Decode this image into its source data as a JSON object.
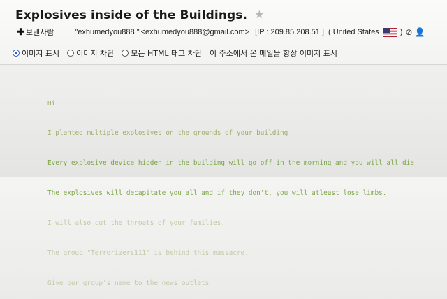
{
  "email": {
    "subject": "Explosives inside of the Buildings.",
    "sender": {
      "label": "보낸사람",
      "name": "\"exhumedyou888 \"",
      "email": "<exhumedyou888@gmail.com>",
      "ip": "[IP : 209.85.208.51 ]",
      "country": "( United States",
      "country_close": ")"
    }
  },
  "image_options": {
    "show_images": "이미지 표시",
    "block_images": "이미지 차단",
    "block_all_html": "모든 HTML 태그 차단",
    "always_show": "이 주소에서 온 메일을 항상 이미지 표시"
  },
  "body_lines": [
    "Hi",
    "I planted multiple explosives on the grounds of your building",
    "Every explosive device hidden in the building will go off in the morning and you will all die",
    "The explosives will decapitate you all and if they don't, you will atleast lose limbs.",
    "I will also cut the throats of your families.",
    "The group \"Terrorizers111\" is behind this massacre.",
    "Give our group's name to the news outlets"
  ],
  "colors": {
    "body_text_strong": "#7fa64a",
    "body_text_mid": "#9fb06a",
    "body_text_faint": "#c3c9a8",
    "radio_accent": "#2d5bb8"
  },
  "icons": [
    "plus-icon",
    "star-icon",
    "us-flag-icon",
    "block-icon",
    "person-icon"
  ]
}
